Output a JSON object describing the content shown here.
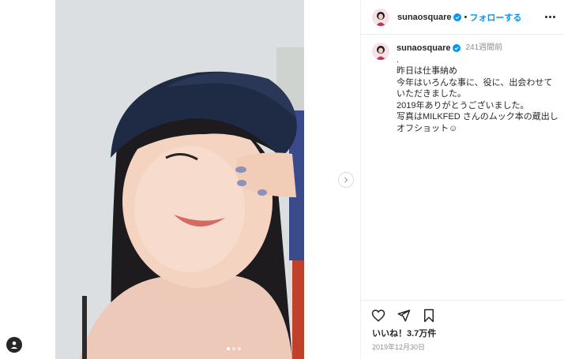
{
  "post": {
    "username": "sunaosquare",
    "separator": "•",
    "follow_label": "フォローする",
    "time_ago": "241週間前",
    "caption_lines": [
      ".",
      "昨日は仕事納め",
      "今年はいろんな事に、役に、出会わせて",
      "いただきました。",
      "2019年ありがとうございました。",
      "写真はMILKFED さんのムック本の蔵出し",
      "オフショット☺"
    ],
    "likes_label": "いいね！3.7万件",
    "date_label": "2019年12月30日"
  },
  "colors": {
    "accent": "#0095f6",
    "muted": "#8e8e8e",
    "text": "#262626"
  },
  "icons": [
    "verified-badge-icon",
    "more-options-icon",
    "next-arrow-icon",
    "heart-icon",
    "share-icon",
    "bookmark-icon",
    "user-tag-icon"
  ]
}
